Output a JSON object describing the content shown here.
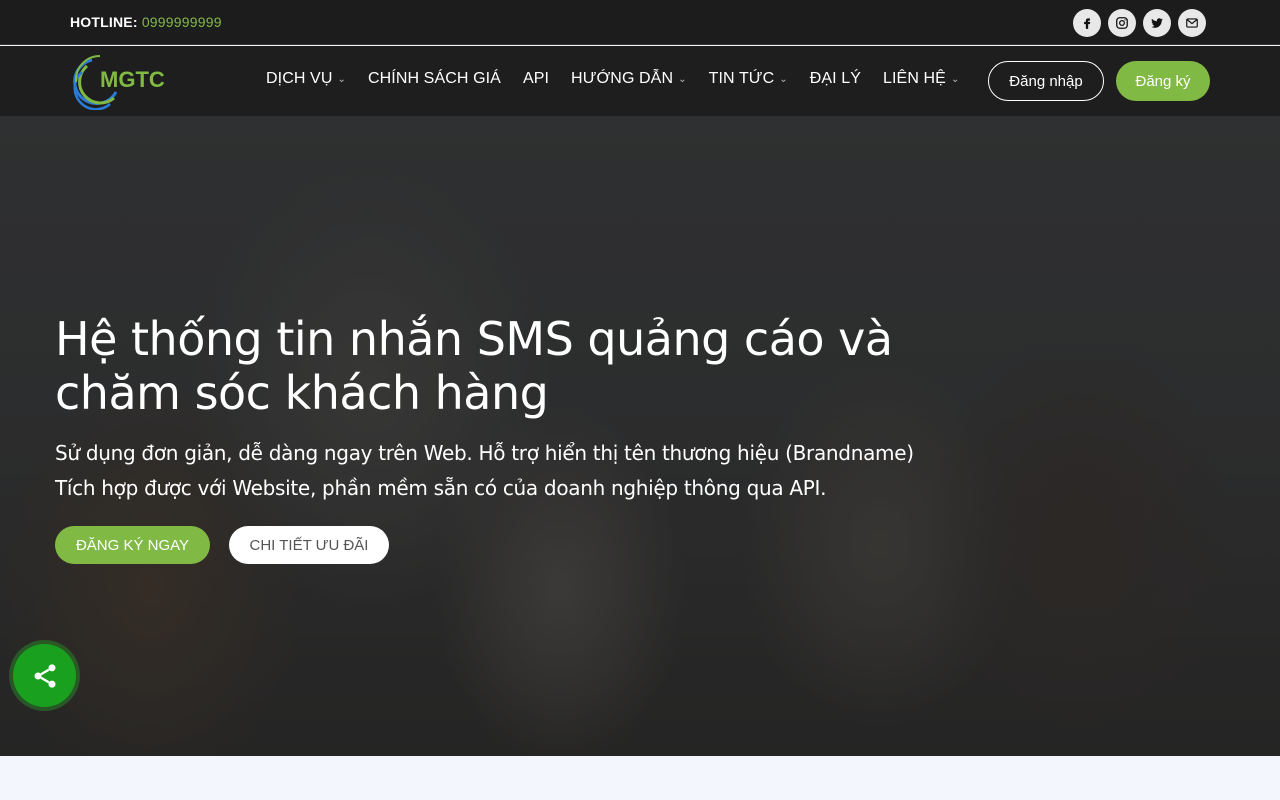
{
  "topbar": {
    "hotline_label": "HOTLINE:",
    "hotline_number": "0999999999",
    "socials": [
      {
        "name": "facebook-icon",
        "glyph": "f"
      },
      {
        "name": "instagram-icon",
        "glyph": ""
      },
      {
        "name": "twitter-icon",
        "glyph": ""
      },
      {
        "name": "email-icon",
        "glyph": ""
      }
    ]
  },
  "logo": {
    "text": "MGTC"
  },
  "nav": {
    "items": [
      {
        "label": "DỊCH VỤ",
        "dropdown": true
      },
      {
        "label": "CHÍNH SÁCH GIÁ",
        "dropdown": false
      },
      {
        "label": "API",
        "dropdown": false
      },
      {
        "label": "HƯỚNG DẪN",
        "dropdown": true
      },
      {
        "label": "TIN TỨC",
        "dropdown": true
      },
      {
        "label": "ĐẠI LÝ",
        "dropdown": false
      },
      {
        "label": "LIÊN HỆ",
        "dropdown": true
      }
    ],
    "login_label": "Đăng nhập",
    "register_label": "Đăng ký"
  },
  "hero": {
    "title": "Hệ thống tin nhắn SMS quảng cáo và chăm sóc khách hàng",
    "sub_line1": "Sử dụng đơn giản, dễ dàng ngay trên Web. Hỗ trợ hiển thị tên thương hiệu (Brandname)",
    "sub_line2": "Tích hợp được với Website, phần mềm sẵn có của doanh nghiệp thông qua API.",
    "cta_primary": "ĐĂNG KÝ NGAY",
    "cta_secondary": "CHI TIẾT ƯU ĐÃI"
  },
  "colors": {
    "accent": "#81b945",
    "topbar_bg": "#1c1c1c",
    "nav_bg": "#1e1e1e",
    "share_bg": "#1aa01f"
  }
}
